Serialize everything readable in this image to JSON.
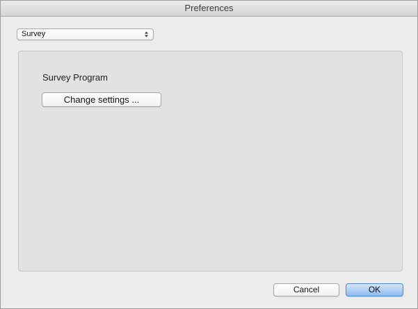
{
  "window": {
    "title": "Preferences"
  },
  "category_popup": {
    "selected": "Survey",
    "icon": "popup-arrows-icon"
  },
  "pane": {
    "section_title": "Survey Program",
    "change_settings_label": "Change settings ..."
  },
  "footer": {
    "cancel_label": "Cancel",
    "ok_label": "OK"
  },
  "colors": {
    "default_button": "#8fbaf0",
    "pane_background": "#e2e2e2",
    "window_background": "#ececec"
  }
}
